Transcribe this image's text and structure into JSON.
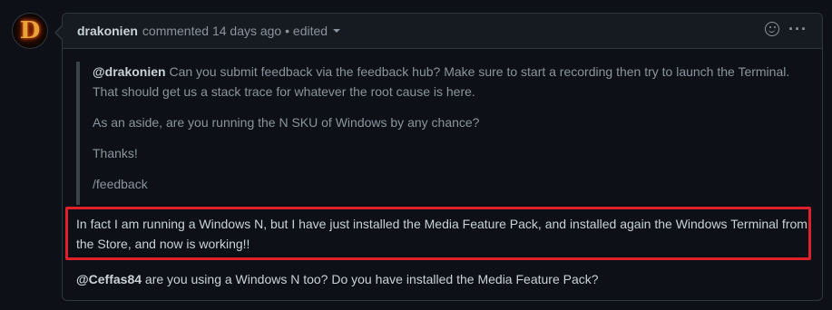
{
  "avatar": {
    "letter": "D"
  },
  "header": {
    "author": "drakonien",
    "meta": "commented 14 days ago • edited"
  },
  "quote": {
    "line1_mention": "@drakonien",
    "line1_text": " Can you submit feedback via the feedback hub? Make sure to start a recording then try to launch the Terminal. That should get us a stack trace for whatever the root cause is here.",
    "line2": "As an aside, are you running the N SKU of Windows by any chance?",
    "line3": "Thanks!",
    "line4": "/feedback"
  },
  "reply": {
    "highlighted": "In fact I am running a Windows N, but I have just installed the Media Feature Pack, and installed again the Windows Terminal from the Store, and now is working!!",
    "mention": "@Ceffas84",
    "followup": " are you using a Windows N too? Do you have installed the Media Feature Pack?"
  },
  "colors": {
    "background": "#0d1117",
    "header_bg": "#161b22",
    "border": "#30363d",
    "highlight_border": "#e0202a"
  }
}
